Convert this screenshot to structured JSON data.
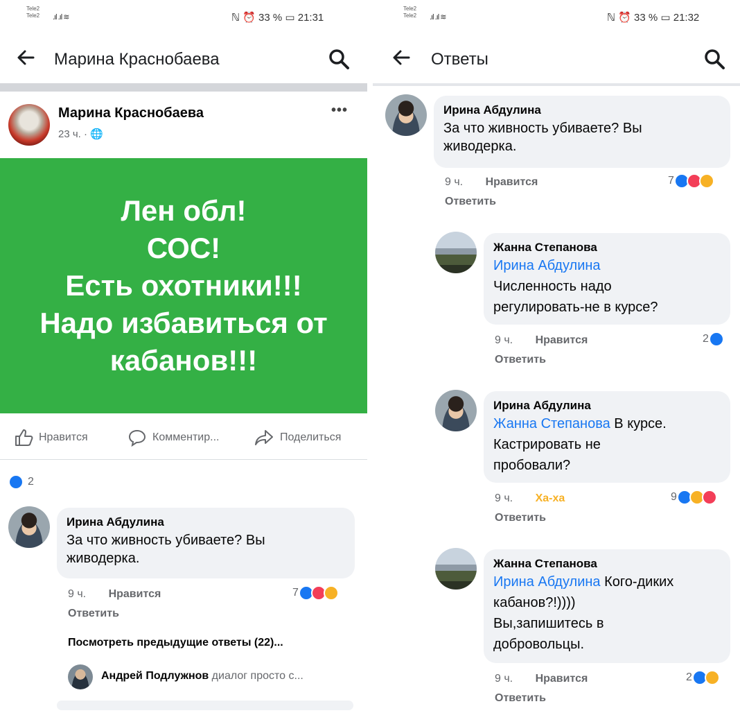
{
  "left": {
    "status": {
      "carrier1": "Tele2",
      "carrier2": "Tele2",
      "right": "ℕ ⏰ 33 % ▭ 21:31"
    },
    "appbar": {
      "title": "Марина Краснобаева"
    },
    "post": {
      "author": "Марина Краснобаева",
      "meta": "23 ч. · 🌐",
      "menu": "•••",
      "lines": [
        "Лен обл!",
        "СОС!",
        "Есть охотники!!!",
        "Надо избавиться от",
        "кабанов!!!"
      ],
      "actions": {
        "like": "Нравится",
        "comment": "Комментир...",
        "share": "Поделиться"
      },
      "like_count": "2"
    },
    "comment": {
      "name": "Ирина Абдулина",
      "text1": "За что живность убиваете? Вы",
      "text2": "живодерка.",
      "time": "9 ч.",
      "like": "Нравится",
      "reply": "Ответить",
      "reactions": "7"
    },
    "more_replies": "Посмотреть предыдущие ответы (22)...",
    "last_reply": {
      "name": "Андрей Подлужнов",
      "text": "диалог просто с..."
    }
  },
  "right": {
    "status": {
      "carrier1": "Tele2",
      "carrier2": "Tele2",
      "right": "ℕ ⏰ 33 % ▭ 21:32"
    },
    "appbar": {
      "title": "Ответы"
    },
    "comments": [
      {
        "name": "Ирина Абдулина",
        "mention": "",
        "lines": [
          "За что живность убиваете? Вы",
          "живодерка."
        ],
        "time": "9 ч.",
        "action": "Нравится",
        "reply": "Ответить",
        "count": "7"
      },
      {
        "name": "Жанна Степанова",
        "mention": "Ирина Абдулина",
        "lines": [
          "Численность надо",
          "регулировать-не в курсе?"
        ],
        "time": "9 ч.",
        "action": "Нравится",
        "reply": "Ответить",
        "count": "2"
      },
      {
        "name": "Ирина Абдулина",
        "mention": "Жанна Степанова",
        "mention_tail": " В курсе.",
        "lines": [
          "Кастрировать не",
          "пробовали?"
        ],
        "time": "9 ч.",
        "action": "Ха-ха",
        "reply": "Ответить",
        "count": "9"
      },
      {
        "name": "Жанна Степанова",
        "mention": "Ирина Абдулина",
        "mention_tail": " Кого-диких",
        "lines": [
          "кабанов?!))))",
          "Вы,запишитесь в",
          "добровольцы."
        ],
        "time": "9 ч.",
        "action": "Нравится",
        "reply": "Ответить",
        "count": "2"
      }
    ]
  },
  "colors": {
    "accent": "#1877f2",
    "green_card": "#34b045",
    "bubble": "#f0f2f5",
    "haha": "#f7b125"
  }
}
